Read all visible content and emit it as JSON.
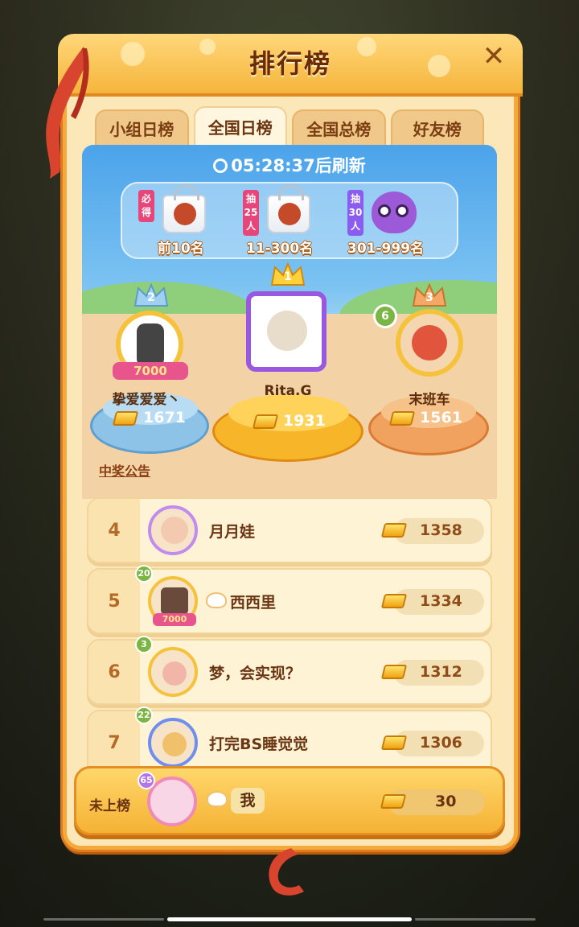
{
  "title": "排行榜",
  "tabs": [
    {
      "label": "小组日榜",
      "active": false
    },
    {
      "label": "全国日榜",
      "active": true
    },
    {
      "label": "全国总榜",
      "active": false
    },
    {
      "label": "好友榜",
      "active": false
    }
  ],
  "timer": {
    "time": "05:28:37",
    "suffix": "后刷新"
  },
  "prizes": [
    {
      "tag": "必得",
      "range": "前10名"
    },
    {
      "tag": "抽25人",
      "range": "11-300名"
    },
    {
      "tag": "抽30人",
      "range": "301-999名"
    }
  ],
  "podium": [
    {
      "rank": "2",
      "name": "挚爱爱爱丶",
      "score": "1671",
      "badge": "7000"
    },
    {
      "rank": "1",
      "name": "Rita.G",
      "score": "1931"
    },
    {
      "rank": "3",
      "name": "末班车",
      "score": "1561",
      "level": "6"
    }
  ],
  "notice": "中奖公告",
  "rows": [
    {
      "rank": "4",
      "name": "月月娃",
      "score": "1358",
      "level": ""
    },
    {
      "rank": "5",
      "name": "西西里",
      "score": "1334",
      "level": "20",
      "badge": "7000"
    },
    {
      "rank": "6",
      "name": "梦，会实现？",
      "score": "1312",
      "level": "3"
    },
    {
      "rank": "7",
      "name": "打完BS睡觉觉",
      "score": "1306",
      "level": "22"
    }
  ],
  "me": {
    "status": "未上榜",
    "level": "65",
    "name": "我",
    "score": "30"
  },
  "colors": {
    "accent": "#f5b53c",
    "border": "#e07b1d",
    "text": "#6b3510",
    "sky": "#4ba3ea"
  },
  "icons": [
    "close-icon",
    "clock-icon",
    "gold-bar-icon",
    "crown-icon",
    "ribbon-icon"
  ]
}
